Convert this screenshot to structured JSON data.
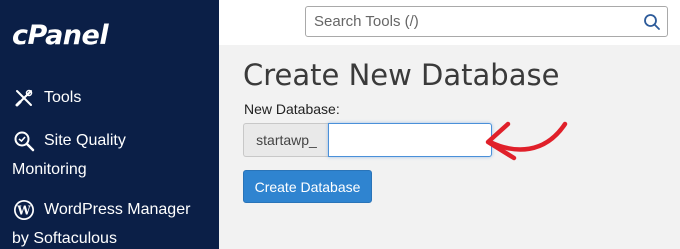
{
  "app": {
    "logo_text": "cPanel"
  },
  "sidebar": {
    "items": [
      {
        "label": "Tools",
        "icon": "tools-icon"
      },
      {
        "label": "Site Quality",
        "label_cont": "Monitoring",
        "icon": "magnifier-icon"
      },
      {
        "label": "WordPress Manager",
        "label_cont": "by Softaculous",
        "icon": "wordpress-icon"
      }
    ]
  },
  "search": {
    "placeholder": "Search Tools (/)",
    "value": ""
  },
  "main": {
    "title": "Create New Database",
    "field_label": "New Database:",
    "prefix": "startawp_",
    "input_value": "",
    "create_button": "Create Database"
  },
  "colors": {
    "sidebar_bg": "#0b1f47",
    "button_bg": "#2f84d0",
    "annotation_arrow": "#e0202a"
  }
}
